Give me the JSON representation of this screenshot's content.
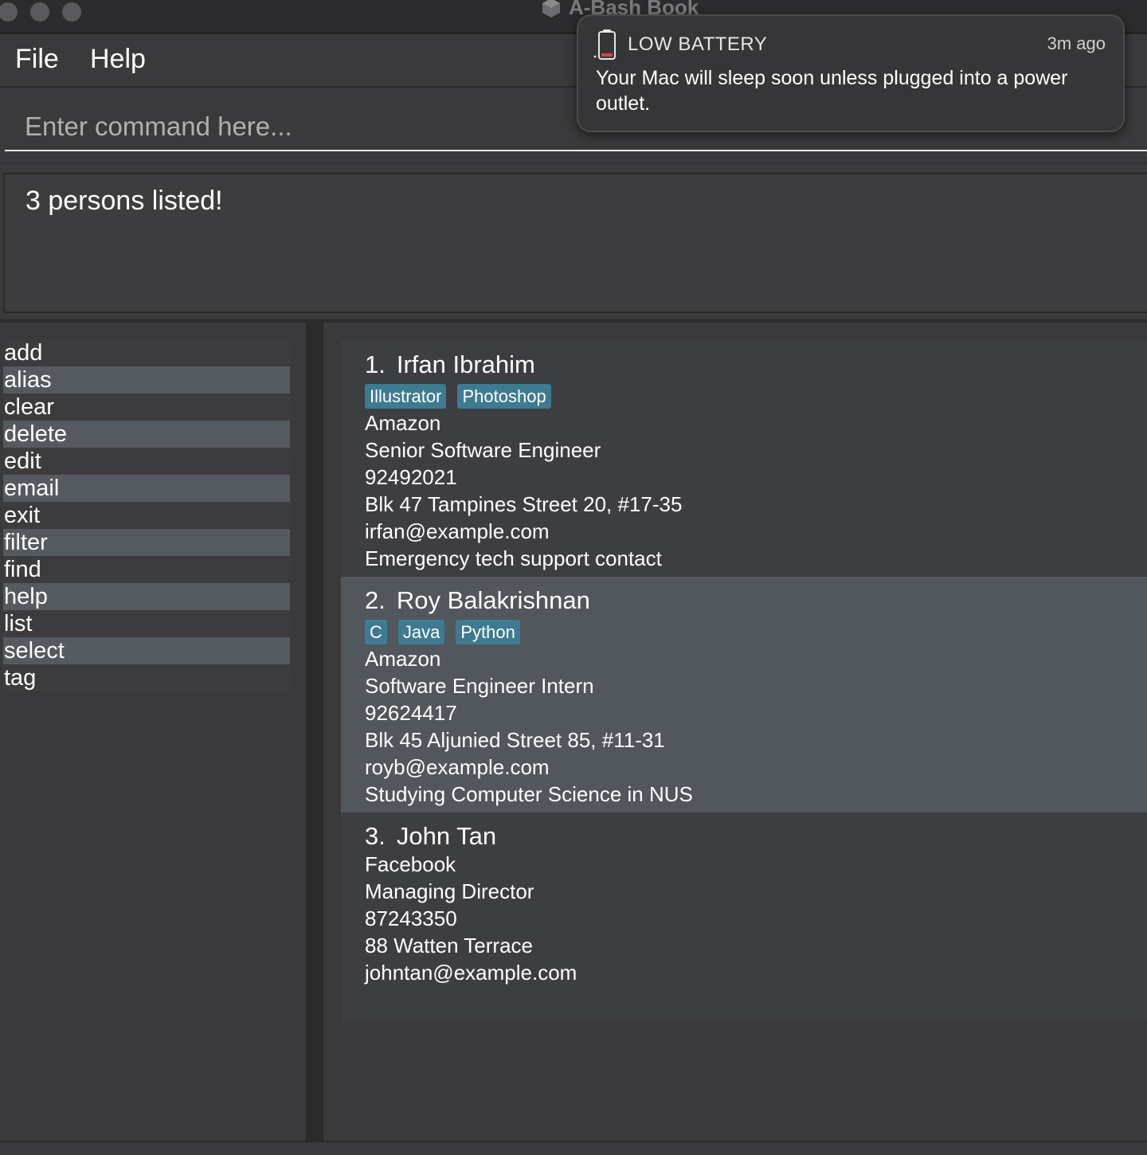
{
  "window": {
    "title": "A-Bash Book"
  },
  "menu": {
    "file": "File",
    "help": "Help"
  },
  "command": {
    "placeholder": "Enter command here...",
    "value": ""
  },
  "result": {
    "message": "3 persons listed!"
  },
  "commands": [
    "add",
    "alias",
    "clear",
    "delete",
    "edit",
    "email",
    "exit",
    "filter",
    "find",
    "help",
    "list",
    "select",
    "tag"
  ],
  "persons": [
    {
      "index": "1.",
      "name": "Irfan Ibrahim",
      "tags": [
        "Illustrator",
        "Photoshop"
      ],
      "company": "Amazon",
      "position": "Senior Software Engineer",
      "phone": "92492021",
      "address": "Blk 47 Tampines Street 20, #17-35",
      "email": "irfan@example.com",
      "remark": "Emergency tech support contact"
    },
    {
      "index": "2.",
      "name": "Roy Balakrishnan",
      "tags": [
        "C",
        "Java",
        "Python"
      ],
      "company": "Amazon",
      "position": "Software Engineer Intern",
      "phone": "92624417",
      "address": "Blk 45 Aljunied Street 85, #11-31",
      "email": "royb@example.com",
      "remark": "Studying Computer Science in NUS"
    },
    {
      "index": "3.",
      "name": "John Tan",
      "tags": [],
      "company": "Facebook",
      "position": "Managing Director",
      "phone": "87243350",
      "address": "88 Watten Terrace",
      "email": "johntan@example.com",
      "remark": ""
    }
  ],
  "notification": {
    "icon": "battery-low-icon",
    "title": "LOW BATTERY",
    "time": "3m ago",
    "body": "Your Mac will sleep soon unless plugged into a power outlet."
  },
  "colors": {
    "tag_background": "#3e7b91",
    "selected_row": "#51575d",
    "battery_low": "#e0443a"
  }
}
